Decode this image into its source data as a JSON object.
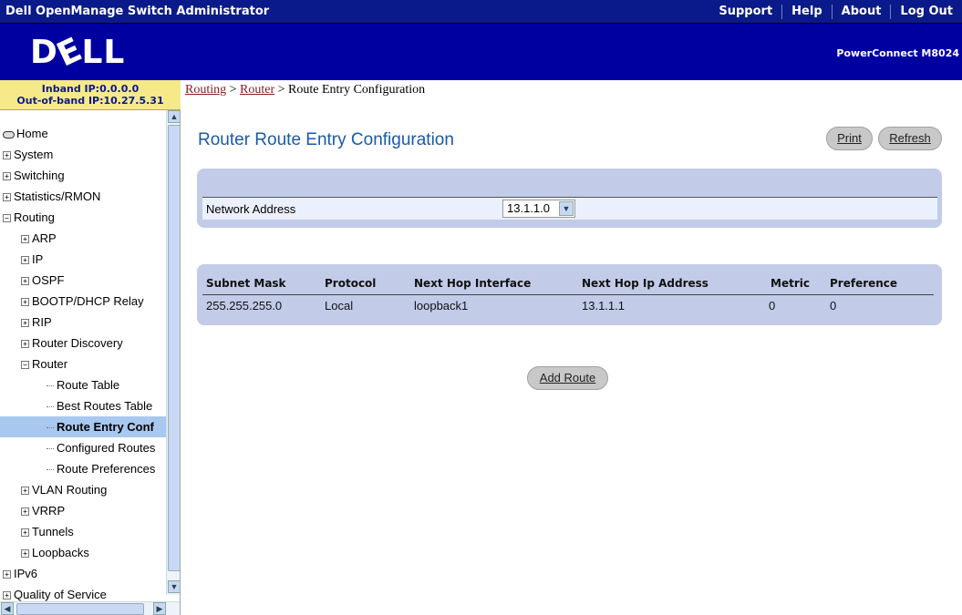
{
  "header": {
    "app_title": "Dell OpenManage Switch Administrator",
    "links": [
      "Support",
      "Help",
      "About",
      "Log Out"
    ]
  },
  "banner": {
    "logo_left": "D",
    "logo_e": "E",
    "logo_right": "LL",
    "model": "PowerConnect M8024"
  },
  "ip_info": {
    "inband": "Inband IP:0.0.0.0",
    "outband": "Out-of-band IP:10.27.5.31"
  },
  "nav": {
    "items": [
      {
        "label": "Home",
        "icon": "home-icon"
      },
      {
        "label": "System",
        "expander": "+"
      },
      {
        "label": "Switching",
        "expander": "+"
      },
      {
        "label": "Statistics/RMON",
        "expander": "+"
      },
      {
        "label": "Routing",
        "expander": "-"
      },
      {
        "label": "ARP",
        "expander": "+"
      },
      {
        "label": "IP",
        "expander": "+"
      },
      {
        "label": "OSPF",
        "expander": "+"
      },
      {
        "label": "BOOTP/DHCP Relay",
        "expander": "+"
      },
      {
        "label": "RIP",
        "expander": "+"
      },
      {
        "label": "Router Discovery",
        "expander": "+"
      },
      {
        "label": "Router",
        "expander": "-"
      },
      {
        "label": "Route Table"
      },
      {
        "label": "Best Routes Table"
      },
      {
        "label": "Route Entry Conf",
        "selected": true
      },
      {
        "label": "Configured Routes"
      },
      {
        "label": "Route Preferences"
      },
      {
        "label": "VLAN Routing",
        "expander": "+"
      },
      {
        "label": "VRRP",
        "expander": "+"
      },
      {
        "label": "Tunnels",
        "expander": "+"
      },
      {
        "label": "Loopbacks",
        "expander": "+"
      },
      {
        "label": "IPv6",
        "expander": "+"
      },
      {
        "label": "Quality of Service",
        "expander": "+"
      }
    ]
  },
  "breadcrumb": {
    "items": [
      "Routing",
      "Router",
      "Route Entry Configuration"
    ],
    "separator": ">"
  },
  "page": {
    "title": "Router Route Entry Configuration",
    "print_label": "Print",
    "refresh_label": "Refresh"
  },
  "network": {
    "label": "Network Address",
    "selected_value": "13.1.1.0"
  },
  "routes": {
    "headers": [
      "Subnet Mask",
      "Protocol",
      "Next Hop Interface",
      "Next Hop Ip Address",
      "Metric",
      "Preference"
    ],
    "rows": [
      [
        "255.255.255.0",
        "Local",
        "loopback1",
        "13.1.1.1",
        "0",
        "0"
      ]
    ]
  },
  "actions": {
    "add_route_label": "Add Route"
  },
  "colors": {
    "topbar": "#0a1a8a",
    "banner": "#0000a0",
    "panel": "#c2cbe8",
    "title": "#1a5aa8",
    "link": "#8a1a1a"
  }
}
